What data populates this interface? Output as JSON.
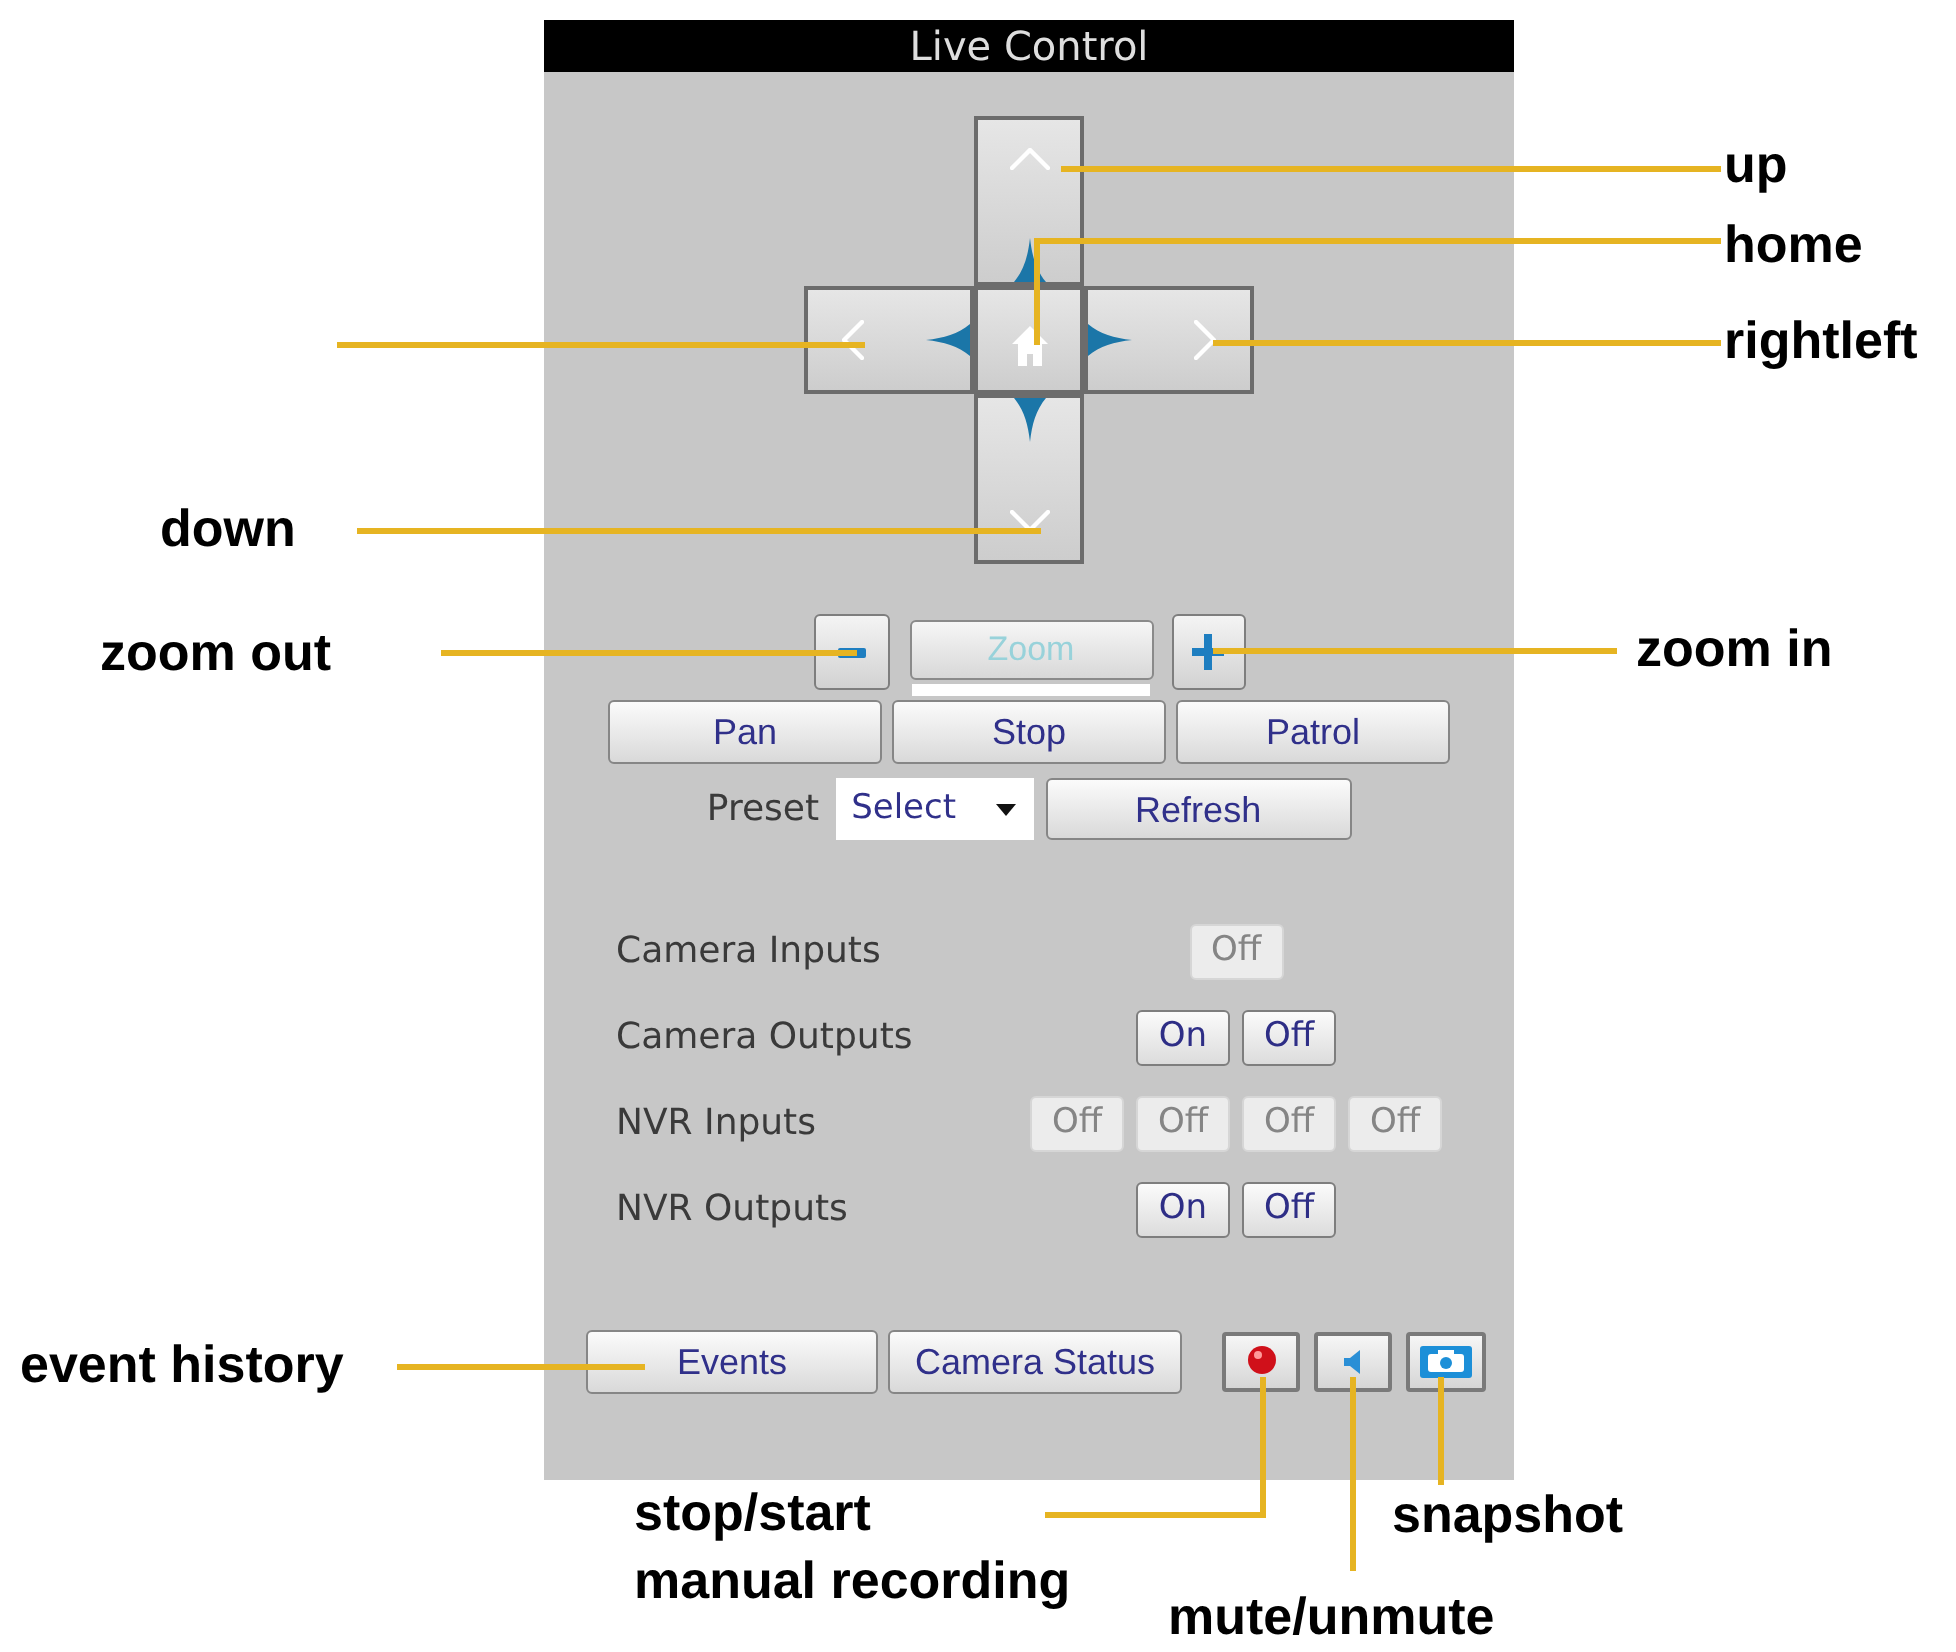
{
  "window": {
    "title": "Live Control"
  },
  "zoom": {
    "label": "Zoom"
  },
  "motion_buttons": [
    {
      "label": "Pan"
    },
    {
      "label": "Stop"
    },
    {
      "label": "Patrol"
    }
  ],
  "preset": {
    "label": "Preset",
    "select": {
      "value": "Select"
    },
    "button": "Refresh"
  },
  "io_rows": [
    {
      "label": "Camera Inputs",
      "buttons": [
        {
          "label": "Off",
          "disabled": true
        }
      ]
    },
    {
      "label": "Camera Outputs",
      "buttons": [
        {
          "label": "On",
          "disabled": false
        },
        {
          "label": "Off",
          "disabled": false
        }
      ]
    },
    {
      "label": "NVR Inputs",
      "buttons": [
        {
          "label": "Off",
          "disabled": true
        },
        {
          "label": "Off",
          "disabled": true
        },
        {
          "label": "Off",
          "disabled": true
        },
        {
          "label": "Off",
          "disabled": true
        }
      ]
    },
    {
      "label": "NVR Outputs",
      "buttons": [
        {
          "label": "On",
          "disabled": false
        },
        {
          "label": "Off",
          "disabled": false
        }
      ]
    }
  ],
  "bottom_buttons": [
    {
      "label": "Events"
    },
    {
      "label": "Camera Status"
    }
  ],
  "callouts": [
    {
      "text": "up"
    },
    {
      "text": "home"
    },
    {
      "text": "rightleft"
    },
    {
      "text": "down"
    },
    {
      "text": "zoom out"
    },
    {
      "text": "zoom in"
    },
    {
      "text": "event history"
    },
    {
      "text": "stop/start\nmanual recording"
    },
    {
      "text": "snapshot"
    },
    {
      "text": "mute/unmute"
    }
  ]
}
